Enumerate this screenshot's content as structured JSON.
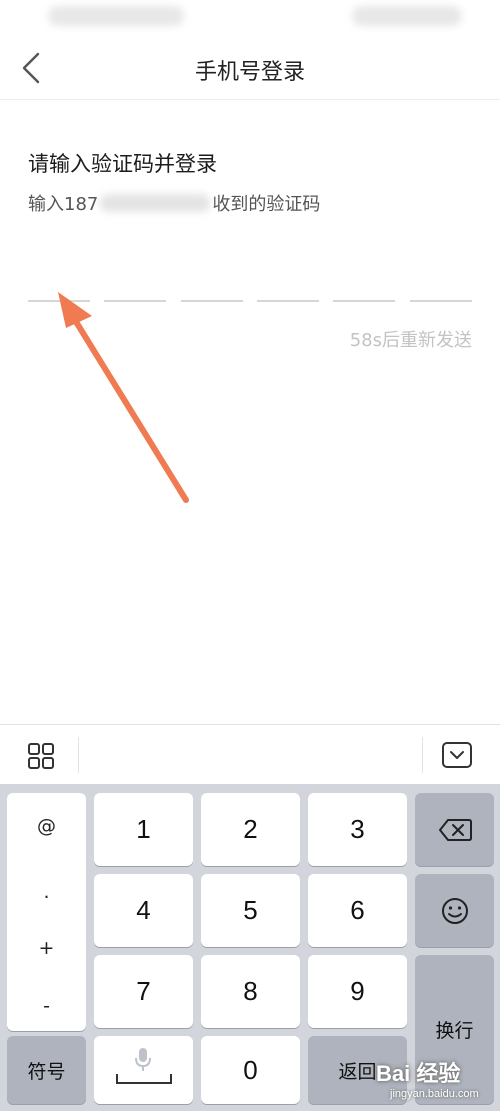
{
  "header": {
    "title": "手机号登录"
  },
  "content": {
    "heading": "请输入验证码并登录",
    "subtitle_prefix": "输入187",
    "subtitle_suffix": "收到的验证码",
    "code_slots": 6,
    "resend": "58s后重新发送"
  },
  "keyboard": {
    "symbols": [
      "@",
      ".",
      "+",
      "-"
    ],
    "digits": [
      "1",
      "2",
      "3",
      "4",
      "5",
      "6",
      "7",
      "8",
      "9",
      "0"
    ],
    "symbol_key": "符号",
    "return_key": "返回",
    "newline_key": "换行"
  },
  "watermark": {
    "main": "Bai 经验",
    "sub": "jingyan.baidu.com"
  },
  "colors": {
    "accent_arrow": "#f07a52",
    "keyboard_bg": "#d2d5db",
    "dark_key": "#aeb3bd"
  }
}
